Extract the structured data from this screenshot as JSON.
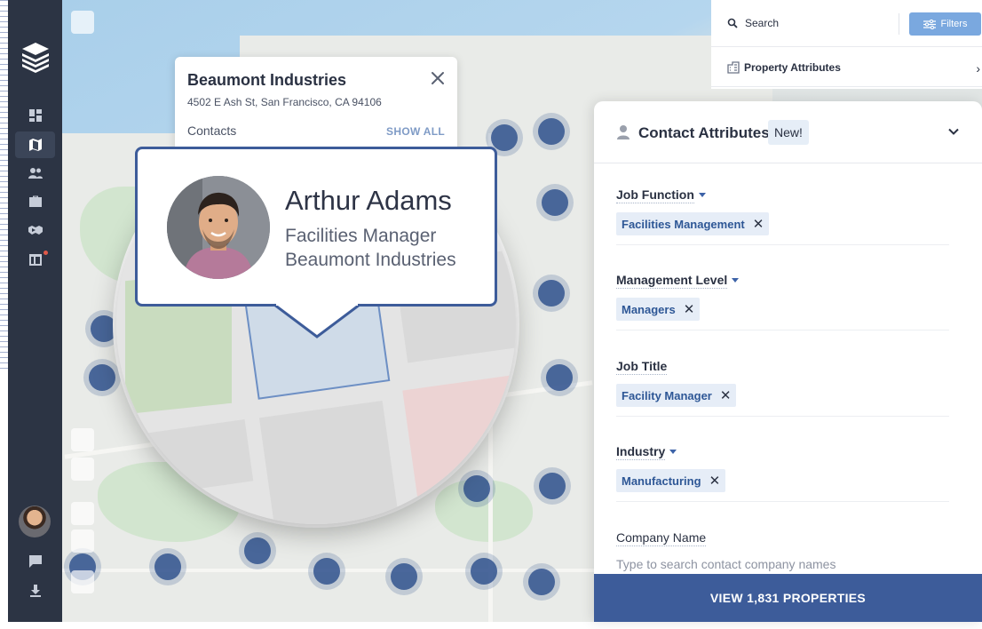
{
  "company_popup": {
    "name": "Beaumont Industries",
    "address": "4502 E Ash St, San Francisco, CA 94106",
    "contacts_label": "Contacts",
    "show_all_label": "SHOW ALL"
  },
  "contact_card": {
    "name": "Arthur Adams",
    "role": "Facilities Manager",
    "company": "Beaumont Industries"
  },
  "top_panel": {
    "search_label": "Search",
    "filters_label": "Filters",
    "property_attributes_label": "Property Attributes"
  },
  "attributes_panel": {
    "title": "Contact Attributes",
    "badge": "New!",
    "fields": [
      {
        "label": "Job Function",
        "chip": "Facilities Management"
      },
      {
        "label": "Management Level",
        "chip": "Managers"
      },
      {
        "label": "Job Title",
        "chip": "Facility Manager"
      },
      {
        "label": "Industry",
        "chip": "Manufacturing"
      }
    ],
    "company_name_label": "Company Name",
    "company_name_placeholder": "Type to search contact company names"
  },
  "cta_label": "VIEW 1,831 PROPERTIES",
  "colors": {
    "sidebar": "#2c3444",
    "primary": "#3d5c9a",
    "chip_bg": "#e6edf7",
    "filters_button": "#7aa8df"
  },
  "icons": {
    "sidebar": [
      "dashboard-icon",
      "map-icon",
      "people-icon",
      "briefcase-icon",
      "handshake-icon",
      "calendar-icon"
    ],
    "sidebar_bottom": [
      "chat-icon",
      "download-icon"
    ]
  }
}
